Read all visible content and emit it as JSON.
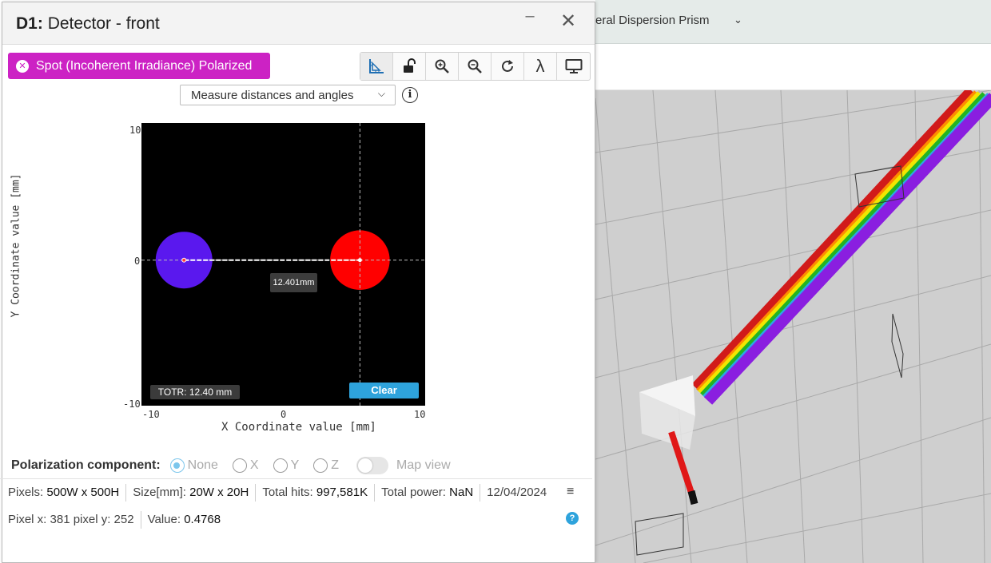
{
  "background_app": {
    "project_title": "eral Dispersion Prism"
  },
  "window": {
    "title_id": "D1:",
    "title_name": "Detector - front",
    "min_glyph": "–",
    "close_glyph": "✕"
  },
  "analysis_button": {
    "label": "Spot (Incoherent Irradiance) Polarized",
    "color": "#cc22c4"
  },
  "toolbar": {
    "tools": [
      "ruler-icon",
      "unlock-icon",
      "zoom-in-icon",
      "zoom-out-icon",
      "refresh-icon",
      "lambda-icon",
      "monitor-icon"
    ],
    "lambda_glyph": "λ"
  },
  "measure": {
    "selected": "Measure distances and angles",
    "info_glyph": "i"
  },
  "chart_data": {
    "type": "heatmap",
    "xlabel": "X Coordinate value [mm]",
    "ylabel": "Y Coordinate value [mm]",
    "xlim": [
      -10,
      10
    ],
    "ylim": [
      -10,
      10
    ],
    "x_ticks": [
      "-10",
      "0",
      "10"
    ],
    "y_ticks": [
      "10",
      "0",
      "-10"
    ],
    "spots": [
      {
        "color": "#5a18ee",
        "x": -7.0,
        "y": 0.3,
        "radius": 2.0
      },
      {
        "color": "#ff0000",
        "x": 5.4,
        "y": 0.3,
        "radius": 2.1
      }
    ],
    "crosshair": {
      "x": 5.4,
      "y": 0.3
    },
    "measurement": {
      "from": [
        -7.0,
        0.3
      ],
      "to": [
        5.4,
        0.3
      ],
      "label": "12.401mm"
    },
    "totr_label": "TOTR: 12.40 mm",
    "clear_label": "Clear"
  },
  "polarization": {
    "label": "Polarization component:",
    "options": [
      "None",
      "X",
      "Y",
      "Z"
    ],
    "selected": "None",
    "map_view_label": "Map view",
    "accent": "#7cc6ec"
  },
  "info": {
    "pixels_label": "Pixels:",
    "pixels_value": "500W x 500H",
    "size_label": "Size[mm]:",
    "size_value": "20W x 20H",
    "hits_label": "Total hits:",
    "hits_value": "997,581K",
    "power_label": "Total power:",
    "power_value": "NaN",
    "date": "12/04/2024",
    "pixel_pos": "Pixel x: 381 pixel y: 252",
    "value_label": "Value:",
    "value": "0.4768",
    "menu_glyph": "≡",
    "help_glyph": "?"
  }
}
